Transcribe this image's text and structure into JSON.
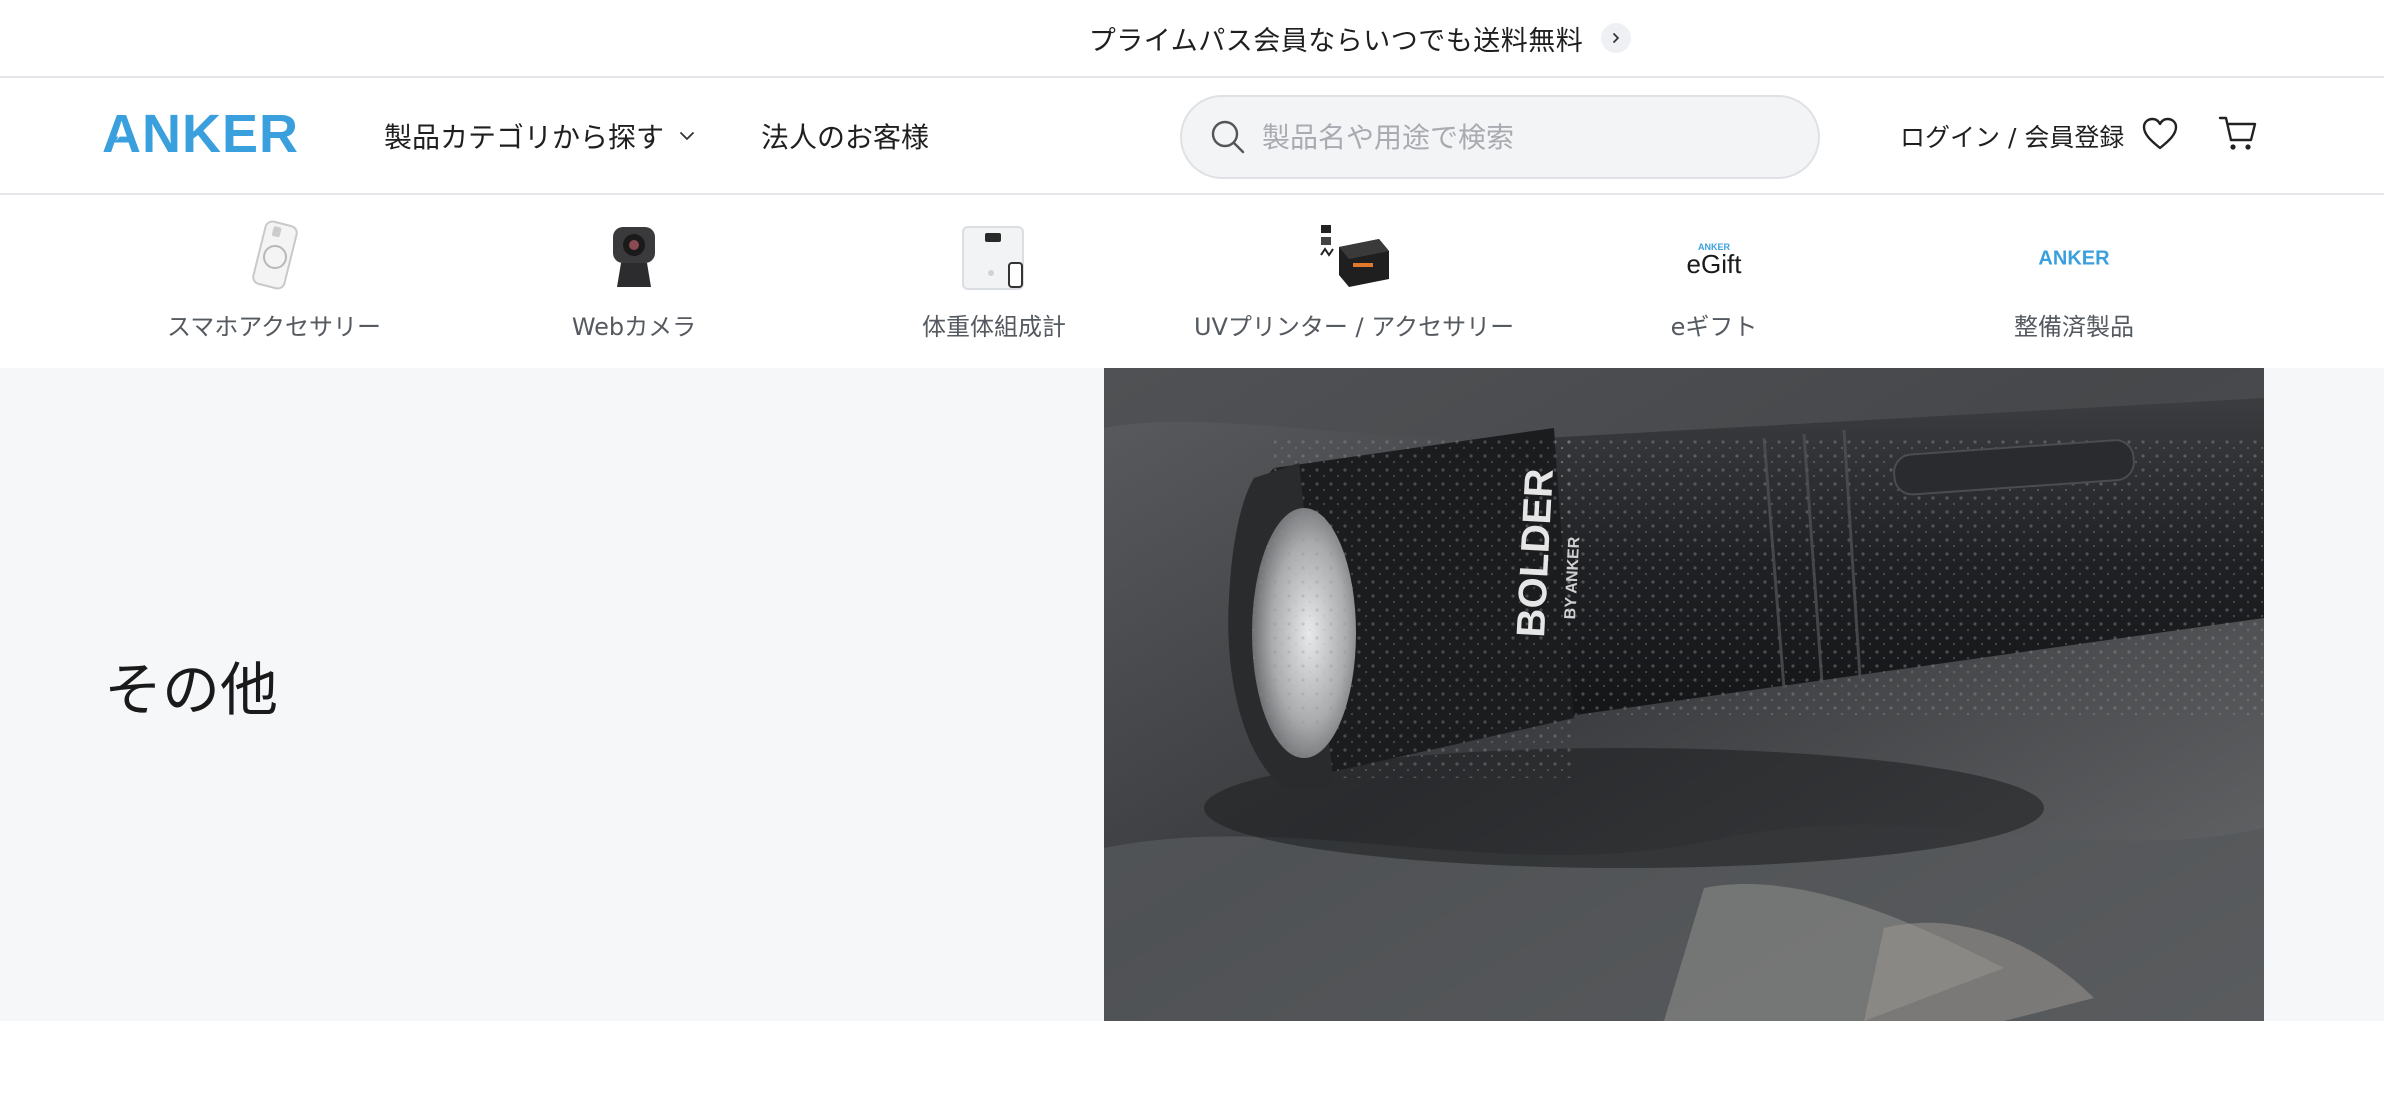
{
  "announcement": {
    "text": "プライムパス会員ならいつでも送料無料",
    "arrow_icon": "chevron-right-icon"
  },
  "header": {
    "logo_text": "ANKER",
    "brand_color": "#3aa0dd",
    "nav": {
      "products_label": "製品カテゴリから探す",
      "business_label": "法人のお客様"
    },
    "search": {
      "placeholder": "製品名や用途で検索"
    },
    "login_label": "ログイン / 会員登録",
    "icons": [
      "search-icon",
      "heart-icon",
      "cart-icon",
      "chevron-down-icon"
    ]
  },
  "categories": [
    {
      "label": "スマホアクセサリー",
      "icon": "phone-case-icon"
    },
    {
      "label": "Webカメラ",
      "icon": "webcam-icon"
    },
    {
      "label": "体重体組成計",
      "icon": "scale-icon"
    },
    {
      "label": "UVプリンター / アクセサリー",
      "icon": "uv-printer-icon"
    },
    {
      "label": "eギフト",
      "icon": "egift-icon",
      "image_text": "eGift",
      "image_subtext": "ANKER"
    },
    {
      "label": "整備済製品",
      "icon": "anker-logo-icon",
      "image_text": "ANKER"
    }
  ],
  "hero": {
    "title": "その他",
    "image": {
      "subject": "flashlight-photo",
      "brand_text": "BOLDER",
      "brand_subtext": "BY ANKER"
    }
  }
}
